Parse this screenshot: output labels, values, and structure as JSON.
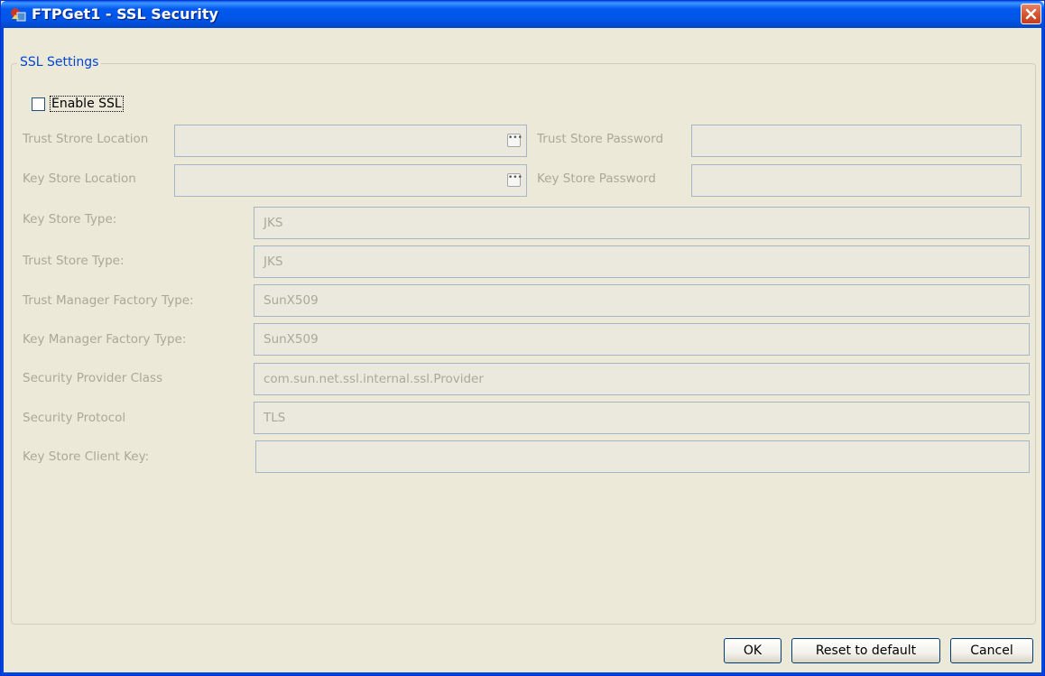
{
  "window": {
    "title": "FTPGet1 - SSL Security"
  },
  "group": {
    "title": "SSL Settings"
  },
  "enable_ssl": {
    "label": "Enable SSL",
    "checked": false
  },
  "trust_store_location": {
    "label": "Trust Strore Location",
    "value": ""
  },
  "trust_store_password": {
    "label": "Trust Store Password",
    "value": ""
  },
  "key_store_location": {
    "label": "Key Store Location",
    "value": ""
  },
  "key_store_password": {
    "label": "Key Store Password",
    "value": ""
  },
  "browse_glyph": "•••",
  "fields": [
    {
      "label": "Key Store Type:",
      "value": "JKS"
    },
    {
      "label": "Trust Store Type:",
      "value": "JKS"
    },
    {
      "label": "Trust Manager Factory Type:",
      "value": "SunX509"
    },
    {
      "label": "Key Manager Factory Type:",
      "value": "SunX509"
    },
    {
      "label": "Security Provider Class",
      "value": "com.sun.net.ssl.internal.ssl.Provider"
    },
    {
      "label": "Security Protocol",
      "value": "TLS"
    },
    {
      "label": "Key Store Client Key:",
      "value": ""
    }
  ],
  "buttons": {
    "ok": "OK",
    "reset": "Reset to default",
    "cancel": "Cancel"
  },
  "colors": {
    "titlebar": "#0055e5",
    "disabled_text": "#aca899",
    "group_title": "#0046d5",
    "close": "#d3542f"
  }
}
